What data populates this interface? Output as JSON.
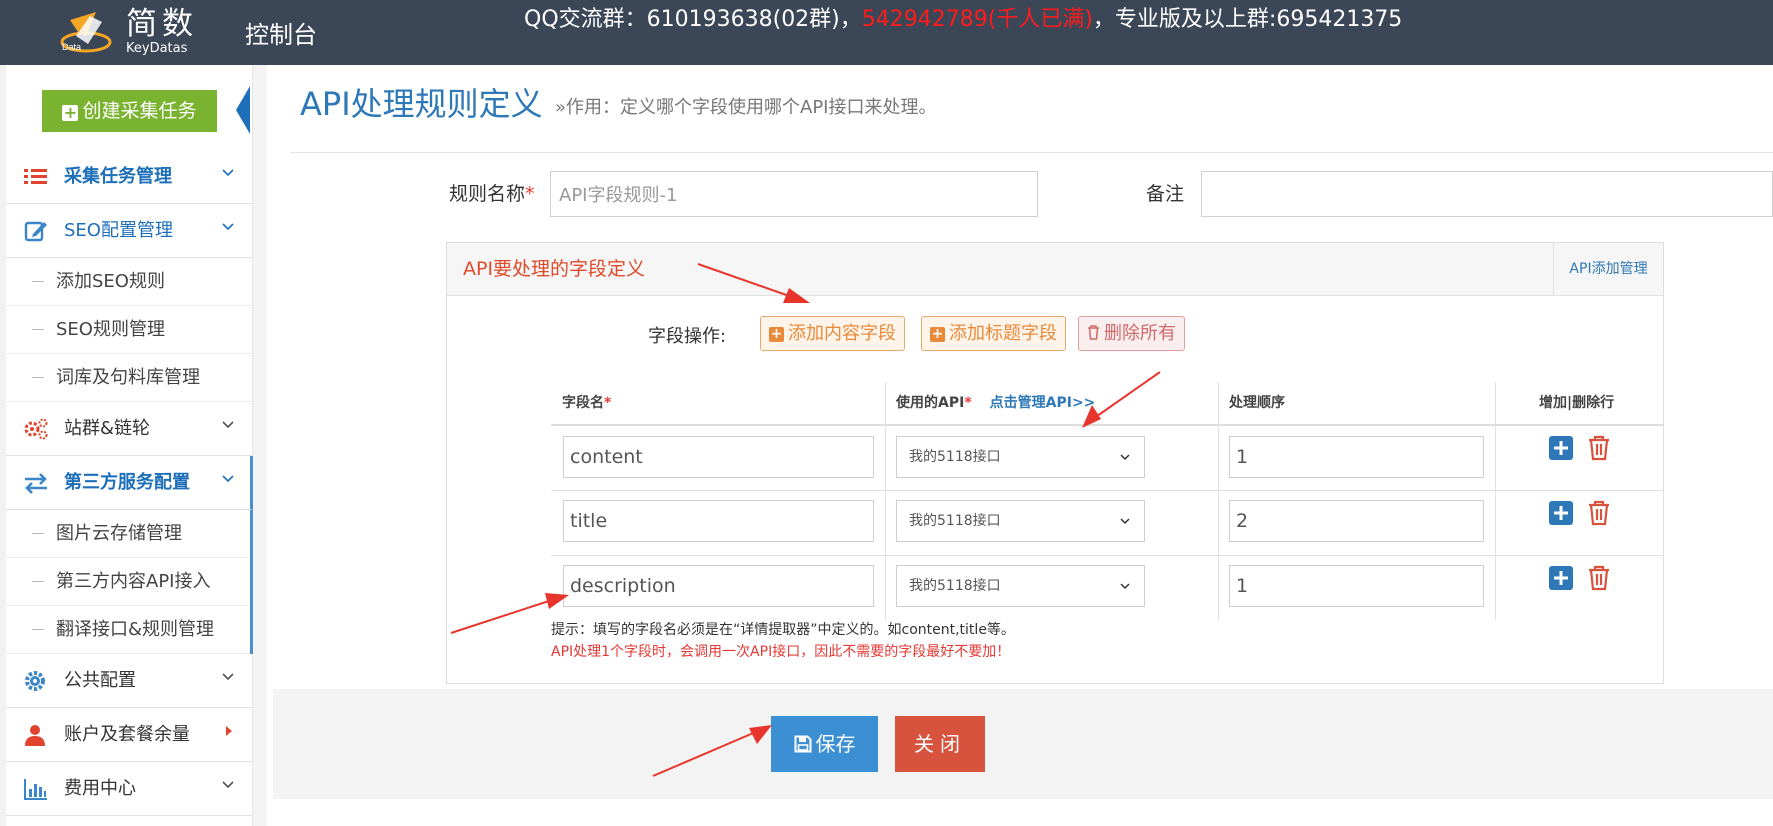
{
  "header": {
    "logo_cn": "简数",
    "logo_en": "KeyDatas",
    "console_title": "控制台",
    "notice_part1": "QQ交流群：610193638(02群)，",
    "notice_red": "542942789(千人已满)",
    "notice_part2": "，专业版及以上群:695421375"
  },
  "sidebar": {
    "create_button": "创建采集任务",
    "items": [
      {
        "label": "采集任务管理",
        "icon": "list-icon"
      },
      {
        "label": "SEO配置管理",
        "icon": "edit-icon"
      },
      {
        "label": "站群&链轮",
        "icon": "gears-icon"
      },
      {
        "label": "第三方服务配置",
        "icon": "exchange-icon"
      },
      {
        "label": "公共配置",
        "icon": "gear-icon"
      },
      {
        "label": "账户及套餐余量",
        "icon": "user-icon"
      },
      {
        "label": "费用中心",
        "icon": "bar-chart-icon"
      }
    ],
    "seo_sub": [
      "添加SEO规则",
      "SEO规则管理",
      "词库及句料库管理"
    ],
    "third_sub": [
      "图片云存储管理",
      "第三方内容API接入",
      "翻译接口&规则管理"
    ]
  },
  "page": {
    "title": "API处理规则定义",
    "subtitle": "»作用：定义哪个字段使用哪个API接口来处理。"
  },
  "form": {
    "rule_name_label": "规则名称",
    "required_mark": "*",
    "rule_name_value": "API字段规则-1",
    "remark_label": "备注",
    "remark_value": ""
  },
  "panel": {
    "title": "API要处理的字段定义",
    "manage_link": "API添加管理",
    "field_ops_label": "字段操作:",
    "add_content_btn": "添加内容字段",
    "add_title_btn": "添加标题字段",
    "delete_all_btn": "删除所有"
  },
  "table": {
    "col_field": "字段名",
    "col_api": "使用的API",
    "col_api_link": "点击管理API>>",
    "col_order": "处理顺序",
    "col_ops": "增加|删除行",
    "rows": [
      {
        "field": "content",
        "api": "我的5118接口",
        "order": "1"
      },
      {
        "field": "title",
        "api": "我的5118接口",
        "order": "2"
      },
      {
        "field": "description",
        "api": "我的5118接口",
        "order": "1"
      }
    ]
  },
  "hints": {
    "hint": "提示：填写的字段名必须是在“详情提取器”中定义的。如content,title等。",
    "warning": "API处理1个字段时，会调用一次API接口，因此不需要的字段最好不要加！"
  },
  "actions": {
    "save": "保存",
    "close": "关闭"
  },
  "colors": {
    "topbar": "#3b4657",
    "accent_blue": "#2e78b7",
    "create_green": "#7ab32f",
    "close_red": "#d8533d",
    "annotation_red": "#e8352c"
  }
}
